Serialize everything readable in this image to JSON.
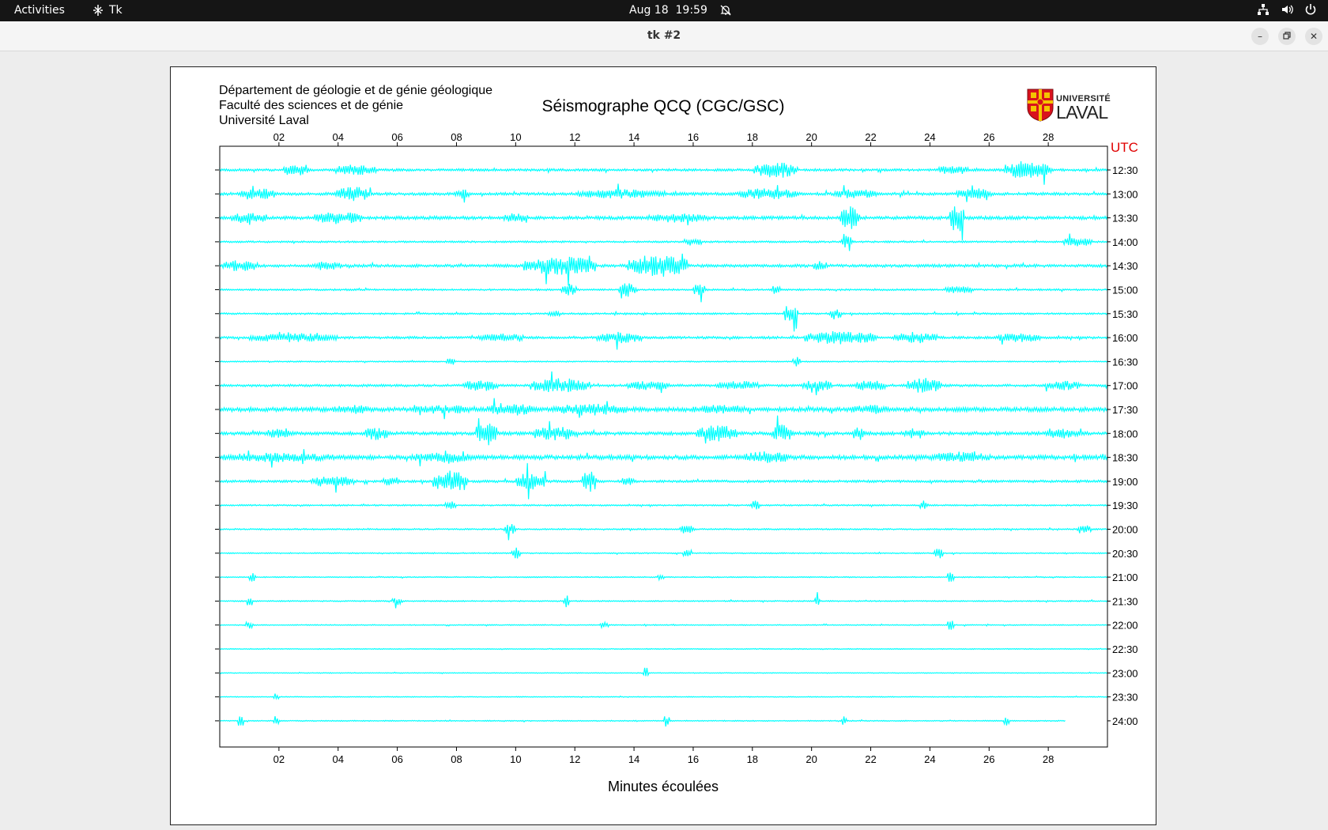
{
  "topbar": {
    "activities": "Activities",
    "app_name": "Tk",
    "date": "Aug 18",
    "time": "19:59"
  },
  "window": {
    "title": "tk #2"
  },
  "header": {
    "line1": "Département de géologie et de génie géologique",
    "line2": "Faculté des sciences et de génie",
    "line3": "Université Laval"
  },
  "logo": {
    "line1": "UNIVERSITÉ",
    "line2": "LAVAL"
  },
  "colors": {
    "trace": "#00ffff",
    "utc": "#e00000",
    "axis": "#000000"
  },
  "chart_data": {
    "type": "line",
    "title": "Séismographe QCQ (CGC/GSC)",
    "xlabel": "Minutes écoulées",
    "ylabel": "UTC",
    "xlim": [
      0,
      30
    ],
    "x_ticks": [
      "02",
      "04",
      "06",
      "08",
      "10",
      "12",
      "14",
      "16",
      "18",
      "20",
      "22",
      "24",
      "26",
      "28"
    ],
    "y_ticks": [
      "12:30",
      "13:00",
      "13:30",
      "14:00",
      "14:30",
      "15:00",
      "15:30",
      "16:00",
      "16:30",
      "17:00",
      "17:30",
      "18:00",
      "18:30",
      "19:00",
      "19:30",
      "20:00",
      "20:30",
      "21:00",
      "21:30",
      "22:00",
      "22:30",
      "23:00",
      "23:30",
      "24:00"
    ],
    "series": [
      {
        "noise": 0.25,
        "bursts": [
          [
            2.6,
            0.9,
            1.2
          ],
          [
            4.6,
            1.4,
            1.2
          ],
          [
            18.8,
            1.5,
            1.7
          ],
          [
            24.8,
            1.0,
            1.0
          ],
          [
            27.3,
            1.6,
            1.9
          ]
        ]
      },
      {
        "noise": 0.3,
        "bursts": [
          [
            1.3,
            1.2,
            1.2
          ],
          [
            4.5,
            1.2,
            1.6
          ],
          [
            8.2,
            0.5,
            1.0
          ],
          [
            13.6,
            3.0,
            1.0
          ],
          [
            18.5,
            2.0,
            1.2
          ],
          [
            21.5,
            1.5,
            1.0
          ],
          [
            25.5,
            1.2,
            1.2
          ]
        ]
      },
      {
        "noise": 0.35,
        "bursts": [
          [
            1.0,
            1.2,
            1.2
          ],
          [
            4.0,
            1.6,
            1.3
          ],
          [
            10.0,
            0.8,
            1.0
          ],
          [
            15.5,
            2.0,
            1.0
          ],
          [
            21.3,
            0.7,
            2.5
          ],
          [
            24.9,
            0.5,
            3.2
          ]
        ]
      },
      {
        "noise": 0.18,
        "bursts": [
          [
            16.0,
            0.6,
            0.9
          ],
          [
            21.2,
            0.4,
            1.3
          ],
          [
            29.0,
            1.0,
            1.0
          ]
        ]
      },
      {
        "noise": 0.3,
        "bursts": [
          [
            0.7,
            1.2,
            1.2
          ],
          [
            3.6,
            1.0,
            1.0
          ],
          [
            11.5,
            2.5,
            2.0
          ],
          [
            14.8,
            2.0,
            2.5
          ],
          [
            20.3,
            0.5,
            1.0
          ]
        ]
      },
      {
        "noise": 0.18,
        "bursts": [
          [
            11.8,
            0.5,
            1.3
          ],
          [
            13.8,
            0.6,
            1.5
          ],
          [
            16.2,
            0.4,
            1.3
          ],
          [
            18.8,
            0.3,
            1.0
          ],
          [
            25.0,
            1.0,
            0.8
          ]
        ]
      },
      {
        "noise": 0.18,
        "bursts": [
          [
            11.3,
            0.4,
            0.8
          ],
          [
            19.3,
            0.5,
            2.0
          ],
          [
            20.8,
            0.4,
            1.3
          ]
        ]
      },
      {
        "noise": 0.25,
        "bursts": [
          [
            2.5,
            3.0,
            1.0
          ],
          [
            9.5,
            1.5,
            0.9
          ],
          [
            13.5,
            1.5,
            1.2
          ],
          [
            21.0,
            2.5,
            1.4
          ],
          [
            23.5,
            1.5,
            1.2
          ],
          [
            27.0,
            1.5,
            1.0
          ]
        ]
      },
      {
        "noise": 0.12,
        "bursts": [
          [
            7.8,
            0.3,
            1.0
          ],
          [
            19.5,
            0.3,
            0.8
          ]
        ]
      },
      {
        "noise": 0.25,
        "bursts": [
          [
            8.8,
            1.2,
            1.2
          ],
          [
            11.5,
            2.0,
            1.6
          ],
          [
            14.5,
            1.5,
            1.0
          ],
          [
            17.5,
            1.5,
            1.0
          ],
          [
            20.2,
            1.0,
            1.3
          ],
          [
            22.0,
            1.0,
            1.2
          ],
          [
            23.8,
            1.2,
            1.6
          ],
          [
            28.5,
            1.2,
            1.0
          ]
        ]
      },
      {
        "noise": 0.45,
        "bursts": [
          [
            4.5,
            1.3,
            1.0
          ],
          [
            7.5,
            2.0,
            1.0
          ],
          [
            9.8,
            1.5,
            1.5
          ],
          [
            12.5,
            2.5,
            1.3
          ],
          [
            17.0,
            2.0,
            1.0
          ],
          [
            22.0,
            1.5,
            1.0
          ]
        ]
      },
      {
        "noise": 0.35,
        "bursts": [
          [
            2.0,
            1.0,
            1.0
          ],
          [
            5.3,
            0.8,
            1.4
          ],
          [
            9.0,
            0.7,
            2.6
          ],
          [
            11.3,
            1.5,
            1.5
          ],
          [
            16.8,
            1.4,
            1.8
          ],
          [
            19.0,
            0.7,
            2.0
          ],
          [
            21.6,
            0.4,
            1.5
          ],
          [
            23.5,
            0.7,
            1.3
          ],
          [
            28.5,
            1.2,
            1.1
          ]
        ]
      },
      {
        "noise": 0.45,
        "bursts": [
          [
            2.0,
            4.0,
            1.0
          ],
          [
            7.5,
            2.0,
            1.2
          ],
          [
            18.5,
            1.5,
            1.3
          ],
          [
            25.0,
            2.0,
            1.2
          ]
        ]
      },
      {
        "noise": 0.25,
        "bursts": [
          [
            3.8,
            1.5,
            1.3
          ],
          [
            5.8,
            0.6,
            1.0
          ],
          [
            7.8,
            1.2,
            2.2
          ],
          [
            10.5,
            1.0,
            2.0
          ],
          [
            12.5,
            0.5,
            2.3
          ],
          [
            13.8,
            0.5,
            1.0
          ]
        ]
      },
      {
        "noise": 0.15,
        "bursts": [
          [
            7.8,
            0.4,
            1.2
          ],
          [
            18.1,
            0.3,
            1.0
          ],
          [
            23.8,
            0.3,
            1.0
          ]
        ]
      },
      {
        "noise": 0.15,
        "bursts": [
          [
            9.8,
            0.4,
            1.2
          ],
          [
            15.8,
            0.5,
            1.0
          ],
          [
            29.2,
            0.5,
            1.0
          ]
        ]
      },
      {
        "noise": 0.12,
        "bursts": [
          [
            10.0,
            0.3,
            1.2
          ],
          [
            15.8,
            0.3,
            1.0
          ],
          [
            24.3,
            0.3,
            1.2
          ]
        ]
      },
      {
        "noise": 0.1,
        "bursts": [
          [
            1.1,
            0.2,
            1.2
          ],
          [
            14.9,
            0.2,
            0.8
          ],
          [
            24.7,
            0.2,
            1.3
          ]
        ]
      },
      {
        "noise": 0.12,
        "bursts": [
          [
            1.0,
            0.2,
            1.3
          ],
          [
            6.0,
            0.4,
            0.8
          ],
          [
            11.7,
            0.2,
            1.3
          ],
          [
            20.2,
            0.2,
            1.0
          ]
        ]
      },
      {
        "noise": 0.1,
        "bursts": [
          [
            1.0,
            0.3,
            0.8
          ],
          [
            13.0,
            0.3,
            0.7
          ],
          [
            24.7,
            0.2,
            1.5
          ]
        ]
      },
      {
        "noise": 0.08,
        "bursts": []
      },
      {
        "noise": 0.08,
        "bursts": [
          [
            14.4,
            0.2,
            1.2
          ]
        ]
      },
      {
        "noise": 0.08,
        "bursts": [
          [
            1.9,
            0.2,
            0.8
          ]
        ]
      },
      {
        "noise": 0.1,
        "end": 28.6,
        "bursts": [
          [
            0.7,
            0.2,
            1.5
          ],
          [
            1.9,
            0.2,
            1.3
          ],
          [
            15.1,
            0.2,
            1.3
          ],
          [
            21.1,
            0.2,
            1.0
          ],
          [
            26.6,
            0.2,
            1.0
          ]
        ]
      }
    ]
  }
}
